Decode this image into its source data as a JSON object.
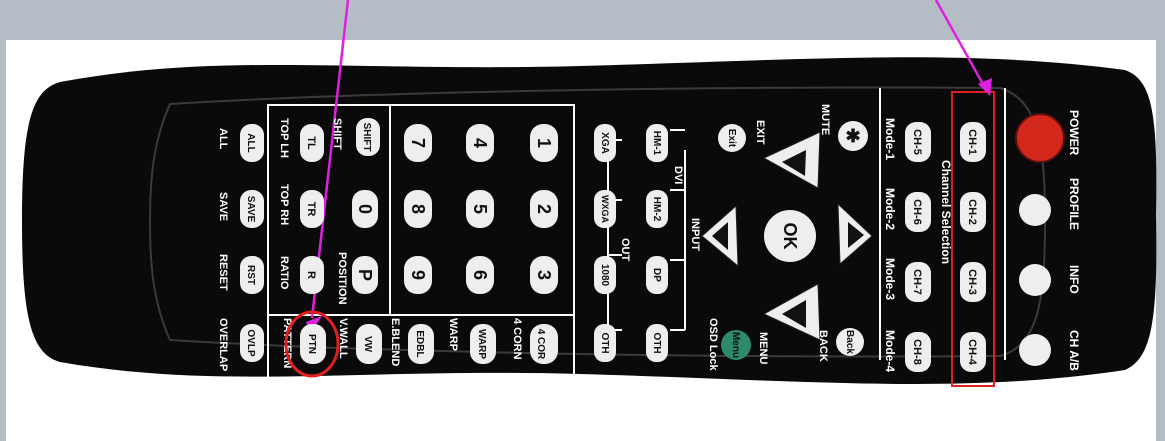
{
  "colors": {
    "frame": "#b4bcc6",
    "remote_body": "#0a0a0a",
    "panel_line": "#ffffff",
    "key_fill": "#eeeeee",
    "power_red": "#d4271c",
    "menu_green": "#2e8b6a",
    "highlight_red": "#e02020",
    "arrow_magenta": "#e020e0"
  },
  "labels": {
    "power": "POWER",
    "profile": "PROFILE",
    "info": "INFO",
    "chab": "CH A/B",
    "channel_selection": "Channel Selection",
    "mode1": "Mode-1",
    "mode2": "Mode-2",
    "mode3": "Mode-3",
    "mode4": "Mode-4",
    "mute": "MUTE",
    "exit": "EXIT",
    "back": "BACK",
    "menu": "MENU",
    "osd_lock": "OSD Lock",
    "dvi": "DVI",
    "input": "INPUT",
    "out": "OUT",
    "four_corn": "4 CORN",
    "warp": "WARP",
    "eblend": "E.BLEND",
    "vwall": "V.WALL",
    "pattern": "PATTERN",
    "shift": "SHIFT",
    "position": "POSITION",
    "all": "ALL",
    "save": "SAVE",
    "reset": "RESET",
    "overlap": "OVERLAP",
    "top_lh": "TOP LH",
    "top_rh": "TOP RH",
    "ratio": "RATIO"
  },
  "keys": {
    "ch1": "CH-1",
    "ch2": "CH-2",
    "ch3": "CH-3",
    "ch4": "CH-4",
    "ch5": "CH-5",
    "ch6": "CH-6",
    "ch7": "CH-7",
    "ch8": "CH-8",
    "exit": "Exit",
    "back": "Back",
    "menu": "Menu",
    "ok": "OK",
    "hm1": "HM-1",
    "hm2": "HM-2",
    "dp": "DP",
    "oth_in": "OTH",
    "xga": "XGA",
    "wxga": "WXGA",
    "r1080": "1080",
    "oth_out": "OTH",
    "n1": "1",
    "n2": "2",
    "n3": "3",
    "n4": "4",
    "n5": "5",
    "n6": "6",
    "n7": "7",
    "n8": "8",
    "n9": "9",
    "n0": "0",
    "p": "P",
    "cor4": "4 COR",
    "warp": "WARP",
    "edbl": "EDBL",
    "vw": "VW",
    "ptn": "PTN",
    "shift": "SHIFT",
    "tl": "TL",
    "tr": "TR",
    "r": "R",
    "all": "ALL",
    "save": "SAVE",
    "rst": "RST",
    "ovlp": "OVLP"
  }
}
